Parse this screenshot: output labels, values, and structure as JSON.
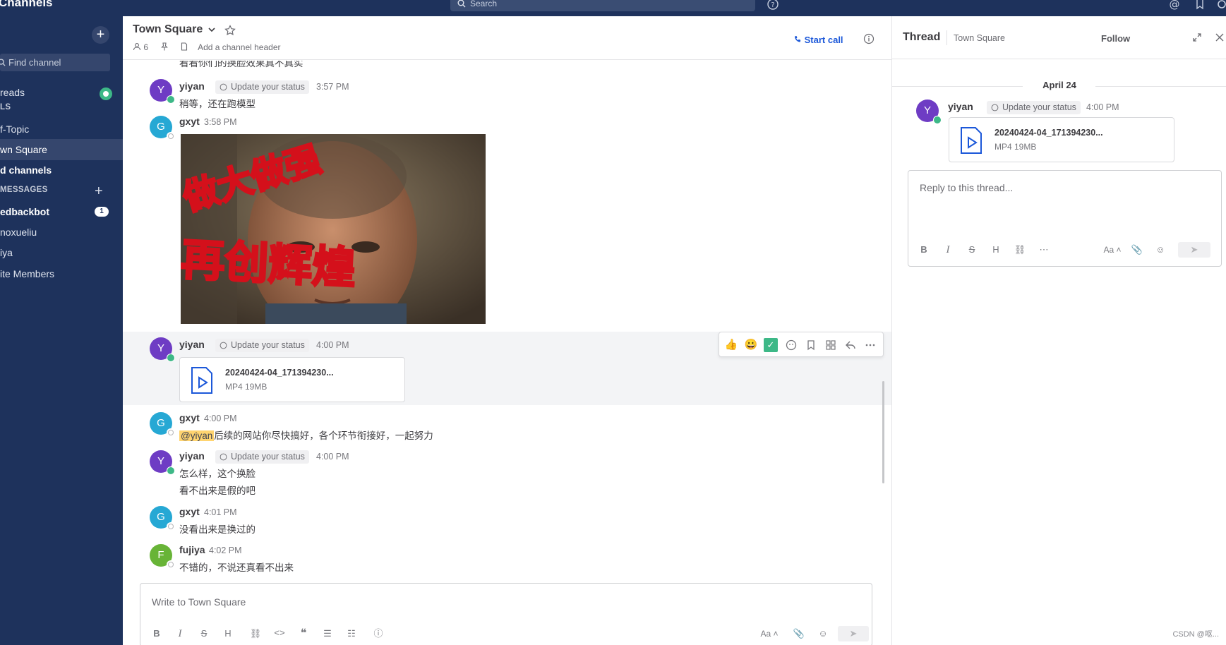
{
  "topbar": {
    "product_name": "Channels",
    "search_placeholder": "Search"
  },
  "sidebar": {
    "find_channel": "Find channel",
    "threads_label": "reads",
    "channels_header": "LS",
    "channels": [
      {
        "label": "f-Topic"
      },
      {
        "label": "wn Square"
      }
    ],
    "more_channels": "d channels",
    "dm_header": "MESSAGES",
    "dms": [
      {
        "label": "edbackbot",
        "badge": "1"
      },
      {
        "label": "noxueliu"
      },
      {
        "label": "iya"
      }
    ],
    "invite": "ite Members"
  },
  "channel": {
    "name": "Town Square",
    "member_count": "6",
    "header_placeholder": "Add a channel header",
    "start_call": "Start call"
  },
  "messages": {
    "top_cut_text": "看看你们的换脸效果真不真实",
    "m1": {
      "user": "yiyan",
      "avatar": "Y",
      "status": "Update your status",
      "time": "3:57 PM",
      "text": "稍等，还在跑模型"
    },
    "m2": {
      "user": "gxyt",
      "avatar": "G",
      "time": "3:58 PM",
      "image_text_1": "做大做强",
      "image_text_2": "再创辉煌"
    },
    "m3": {
      "user": "yiyan",
      "avatar": "Y",
      "status": "Update your status",
      "time": "4:00 PM",
      "file_name": "20240424-04_171394230...",
      "file_meta": "MP4 19MB"
    },
    "m4": {
      "user": "gxyt",
      "avatar": "G",
      "time": "4:00 PM",
      "mention": "@yiyan",
      "text": "后续的网站你尽快搞好，各个环节衔接好，一起努力"
    },
    "m5": {
      "user": "yiyan",
      "avatar": "Y",
      "status": "Update your status",
      "time": "4:00 PM",
      "line1": "怎么样，这个换脸",
      "line2": "看不出来是假的吧"
    },
    "m6": {
      "user": "gxyt",
      "avatar": "G",
      "time": "4:01 PM",
      "text": "没看出来是换过的"
    },
    "m7": {
      "user": "fujiya",
      "avatar": "F",
      "time": "4:02 PM",
      "text": "不错的，不说还真看不出来"
    }
  },
  "composer": {
    "placeholder": "Write to Town Square",
    "font_toggle": "Aa"
  },
  "thread": {
    "title": "Thread",
    "channel": "Town Square",
    "follow": "Follow",
    "date": "April 24",
    "post": {
      "user": "yiyan",
      "avatar": "Y",
      "status": "Update your status",
      "time": "4:00 PM",
      "file_name": "20240424-04_171394230...",
      "file_meta": "MP4 19MB"
    },
    "reply_placeholder": "Reply to this thread...",
    "font_toggle": "Aa"
  },
  "watermark": "CSDN @呕...",
  "colors": {
    "sidebar": "#1e325c",
    "accent": "#1c58d9",
    "online": "#3db887",
    "avatar_y": "#6e3cc4",
    "avatar_g": "#26a8d4",
    "avatar_f": "#68b437"
  }
}
